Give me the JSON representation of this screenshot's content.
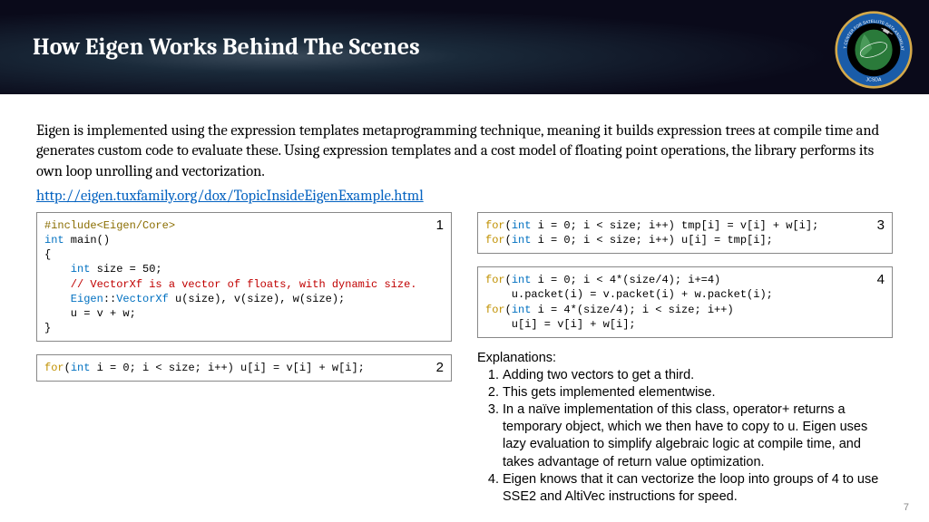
{
  "header": {
    "title": "How Eigen Works Behind The Scenes",
    "logo_outer": "JOINT CENTER FOR SATELLITE DATA ASSIMILATION",
    "logo_inner": "JCSDA"
  },
  "body": {
    "paragraph": "Eigen is implemented using the expression templates metaprogramming technique, meaning it builds expression trees at compile time and generates custom code to evaluate these. Using expression templates and a cost model of floating point operations, the library performs its own loop unrolling and vectorization.",
    "link": "http://eigen.tuxfamily.org/dox/TopicInsideEigenExample.html"
  },
  "code1": {
    "num": "1",
    "l1a": "#include<Eigen/Core>",
    "l2a": "int",
    "l2b": " main()",
    "l3": "{",
    "l4a": "    int",
    "l4b": " size = 50;",
    "l5": "    // VectorXf is a vector of floats, with dynamic size.",
    "l6a": "    Eigen",
    "l6b": "::",
    "l6c": "VectorXf",
    "l6d": " u(size), v(size), w(size);",
    "l7": "    u = v + w;",
    "l8": "}"
  },
  "code2": {
    "num": "2",
    "l1a": "for",
    "l1b": "(",
    "l1c": "int",
    "l1d": " i = 0; i < size; i++) u[i] = v[i] + w[i];"
  },
  "code3": {
    "num": "3",
    "l1a": "for",
    "l1b": "(",
    "l1c": "int",
    "l1d": " i = 0; i < size; i++) tmp[i] = v[i] + w[i];",
    "l2a": "for",
    "l2b": "(",
    "l2c": "int",
    "l2d": " i = 0; i < size; i++) u[i] = tmp[i];"
  },
  "code4": {
    "num": "4",
    "l1a": "for",
    "l1b": "(",
    "l1c": "int",
    "l1d": " i = 0; i < 4*(size/4); i+=4)",
    "l2": "    u.packet(i) = v.packet(i) + w.packet(i);",
    "l3a": "for",
    "l3b": "(",
    "l3c": "int",
    "l3d": " i = 4*(size/4); i < size; i++)",
    "l4": "    u[i] = v[i] + w[i];"
  },
  "explain": {
    "header": "Explanations:",
    "items": [
      "Adding two vectors to get a third.",
      "This gets implemented elementwise.",
      "In a naïve implementation of this class, operator+ returns a temporary object, which we then have to copy to u. Eigen uses lazy evaluation to simplify algebraic logic at compile time, and takes advantage of return value optimization.",
      "Eigen knows that it can vectorize the loop into groups of 4 to use SSE2 and AltiVec instructions for speed."
    ]
  },
  "page_number": "7"
}
